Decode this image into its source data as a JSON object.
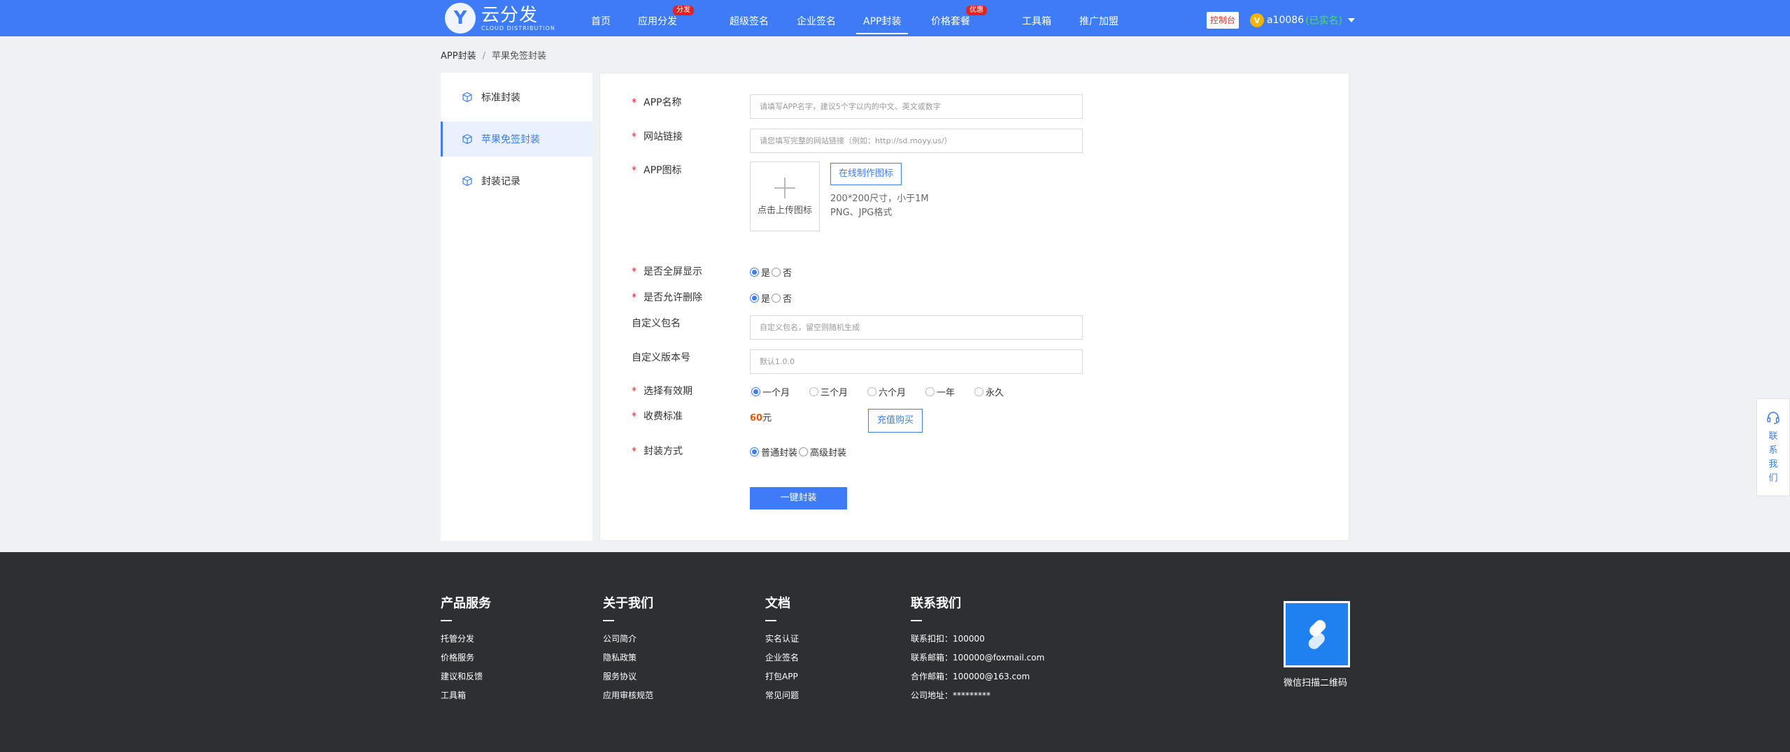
{
  "header": {
    "logo_letter": "Y",
    "logo_name": "云分发",
    "logo_sub": "CLOUD DISTRIBUTION",
    "nav": [
      {
        "label": "首页",
        "badge": ""
      },
      {
        "label": "应用分发",
        "badge": "分发"
      },
      {
        "label": "超级签名",
        "badge": ""
      },
      {
        "label": "企业签名",
        "badge": ""
      },
      {
        "label": "APP封装",
        "badge": ""
      },
      {
        "label": "价格套餐",
        "badge": "优惠"
      },
      {
        "label": "工具箱",
        "badge": ""
      },
      {
        "label": "推广加盟",
        "badge": ""
      }
    ],
    "console": "控制台",
    "user_avatar": "V",
    "username": "a10086",
    "user_status": "(已实名)"
  },
  "breadcrumb": {
    "root": "APP封装",
    "sep": "/",
    "current": "苹果免签封装"
  },
  "sidebar": {
    "items": [
      {
        "label": "标准封装"
      },
      {
        "label": "苹果免签封装"
      },
      {
        "label": "封装记录"
      }
    ]
  },
  "form": {
    "req_mark": "*",
    "app_name": {
      "label": "APP名称",
      "placeholder": "请填写APP名字，建议5个字以内的中文、英文或数字"
    },
    "url": {
      "label": "网站链接",
      "placeholder": "请您填写完整的网站链接（例如：http://sd.moyy.us/）"
    },
    "icon": {
      "label": "APP图标",
      "upload_text": "点击上传图标",
      "make_btn": "在线制作图标",
      "hint1": "200*200尺寸，小于1M",
      "hint2": "PNG、JPG格式"
    },
    "fullscreen": {
      "label": "是否全屏显示",
      "yes": "是",
      "no": "否"
    },
    "allow_delete": {
      "label": "是否允许删除",
      "yes": "是",
      "no": "否"
    },
    "package": {
      "label": "自定义包名",
      "placeholder": "自定义包名，留空则随机生成"
    },
    "version": {
      "label": "自定义版本号",
      "placeholder": "默认1.0.0"
    },
    "validity": {
      "label": "选择有效期",
      "options": [
        "一个月",
        "三个月",
        "六个月",
        "一年",
        "永久"
      ]
    },
    "fee": {
      "label": "收费标准",
      "amount": "60",
      "unit": "元",
      "recharge_btn": "充值购买"
    },
    "method": {
      "label": "封装方式",
      "options": [
        "普通封装",
        "高级封装"
      ]
    },
    "submit": "一键封装"
  },
  "contact_float": {
    "text": "联系我们"
  },
  "footer": {
    "columns": [
      {
        "title": "产品服务",
        "links": [
          "托管分发",
          "价格服务",
          "建议和反馈",
          "工具箱"
        ]
      },
      {
        "title": "关于我们",
        "links": [
          "公司简介",
          "隐私政策",
          "服务协议",
          "应用审核规范"
        ]
      },
      {
        "title": "文档",
        "links": [
          "实名认证",
          "企业签名",
          "打包APP",
          "常见问题"
        ]
      },
      {
        "title": "联系我们",
        "links": [
          "联系扣扣：100000",
          "联系邮箱：100000@foxmail.com",
          "合作邮箱：100000@163.com",
          "公司地址：*********"
        ]
      }
    ],
    "qr_text": "微信扫描二维码"
  },
  "colors": {
    "primary": "#3d7cf6",
    "badge": "#e02424",
    "price": "#e8590c",
    "footer_bg": "#2d2f33",
    "verified": "#4ee05a"
  }
}
